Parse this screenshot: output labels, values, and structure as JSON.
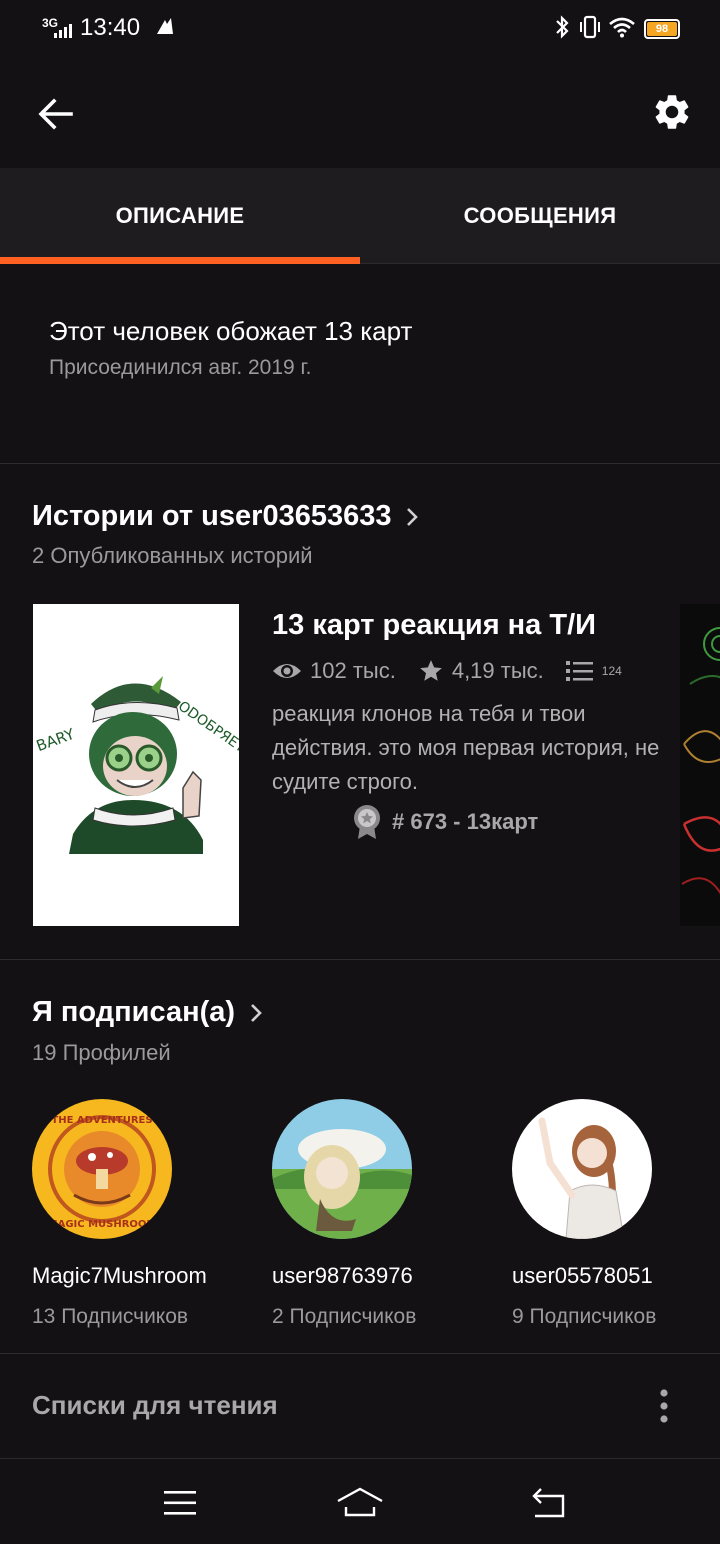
{
  "status_bar": {
    "network": "3G",
    "time": "13:40",
    "battery": "98",
    "icons": [
      "signal-icon",
      "notification-icon",
      "bluetooth-icon",
      "vibrate-icon",
      "wifi-icon",
      "battery-icon"
    ]
  },
  "app_bar": {
    "back_icon": "arrow-left-icon",
    "settings_icon": "gear-icon"
  },
  "tabs": [
    {
      "label": "ОПИСАНИЕ",
      "active": true
    },
    {
      "label": "СООБЩЕНИЯ",
      "active": false
    }
  ],
  "accent_color": "#ff6122",
  "about": {
    "text": "Этот человек обожает 13 карт",
    "joined": "Присоединился авг. 2019 г."
  },
  "stories_section": {
    "title": "Истории от user03653633",
    "subtitle": "2 Опубликованных историй",
    "story": {
      "title": "13 карт реакция на Т/И",
      "views": "102 тыс.",
      "votes": "4,19 тыс.",
      "parts": "124",
      "description": "реакция клонов на тебя и твои действия. это моя первая история, не судите строго.",
      "rank": "# 673 - 13карт",
      "cover_text_left": "BARY",
      "cover_text_right": "ODOБРЯЕТ"
    }
  },
  "following_section": {
    "title": "Я подписан(а)",
    "subtitle": "19 Профилей",
    "profiles": [
      {
        "name": "Magic7Mushroom",
        "followers": "13 Подписчиков",
        "avatar_text": "MAGIC MUSHROOM"
      },
      {
        "name": "user98763976",
        "followers": "2 Подписчиков"
      },
      {
        "name": "user05578051",
        "followers": "9 Подписчиков"
      }
    ]
  },
  "reading_lists": {
    "label": "Списки для чтения"
  },
  "nav_bar": {
    "icons": [
      "menu-icon",
      "home-icon",
      "back-icon"
    ]
  }
}
